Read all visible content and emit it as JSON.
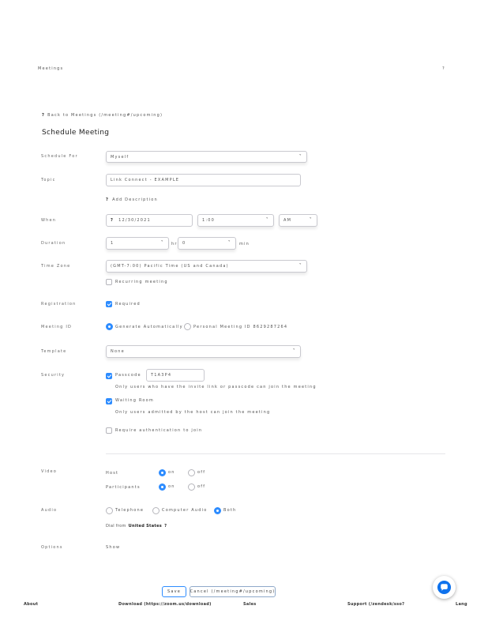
{
  "header": {
    "title": "Meetings",
    "help_icon": "?"
  },
  "back_link": {
    "icon": "?",
    "label": "Back to Meetings (/meeting#/upcoming)"
  },
  "page_title": "Schedule Meeting",
  "form": {
    "schedule_for": {
      "label": "Schedule For",
      "value": "Myself"
    },
    "topic": {
      "label": "Topic",
      "value": "Link Connect - EXAMPLE"
    },
    "add_description": {
      "icon": "?",
      "label": "Add Description"
    },
    "when": {
      "label": "When",
      "date_icon": "?",
      "date": "12/30/2021",
      "time": "1:00",
      "ampm": "AM"
    },
    "duration": {
      "label": "Duration",
      "hours": "1",
      "hr_label": "hr",
      "minutes": "0",
      "min_label": "min"
    },
    "time_zone": {
      "label": "Time Zone",
      "value": "(GMT-7:00) Pacific Time (US and Canada)"
    },
    "recurring": {
      "label": "Recurring meeting",
      "checked": false
    },
    "registration": {
      "label": "Registration",
      "option": "Required",
      "checked": true
    },
    "meeting_id": {
      "label": "Meeting ID",
      "option_auto": "Generate Automatically",
      "option_personal": "Personal Meeting ID 8629287264",
      "selected": "auto"
    },
    "template": {
      "label": "Template",
      "value": "None"
    },
    "security": {
      "label": "Security",
      "passcode_label": "Passcode",
      "passcode_value": "T1A3P4",
      "passcode_checked": true,
      "passcode_hint": "Only users who have the invite link or passcode can join the meeting",
      "waiting_room_label": "Waiting Room",
      "waiting_room_checked": true,
      "waiting_room_hint": "Only users admitted by the host can join the meeting",
      "auth_label": "Require authentication to join",
      "auth_checked": false
    },
    "video": {
      "label": "Video",
      "host_label": "Host",
      "participants_label": "Participants",
      "on": "on",
      "off": "off",
      "host": "on",
      "participants": "on"
    },
    "audio": {
      "label": "Audio",
      "telephone": "Telephone",
      "computer": "Computer Audio",
      "both": "Both",
      "selected": "both",
      "dial_prefix": "Dial from",
      "dial_country": "United States",
      "dial_icon": "?"
    },
    "options": {
      "label": "Options",
      "show": "Show"
    }
  },
  "actions": {
    "save": "Save",
    "cancel": "Cancel (/meeting#/upcoming)"
  },
  "footer": {
    "about": "About",
    "download": "Download (https://zoom.us/download)",
    "sales": "Sales",
    "support": "Support (/zendesk/sso?",
    "language": "Lang"
  },
  "colors": {
    "accent": "#2d8cff",
    "border": "#c9c9cf",
    "chat_bubble": "#0e72ed"
  },
  "icons": {
    "chat": "chat-bubble-icon",
    "checkbox": "checkmark-icon",
    "caret": "chevron-down-icon"
  }
}
